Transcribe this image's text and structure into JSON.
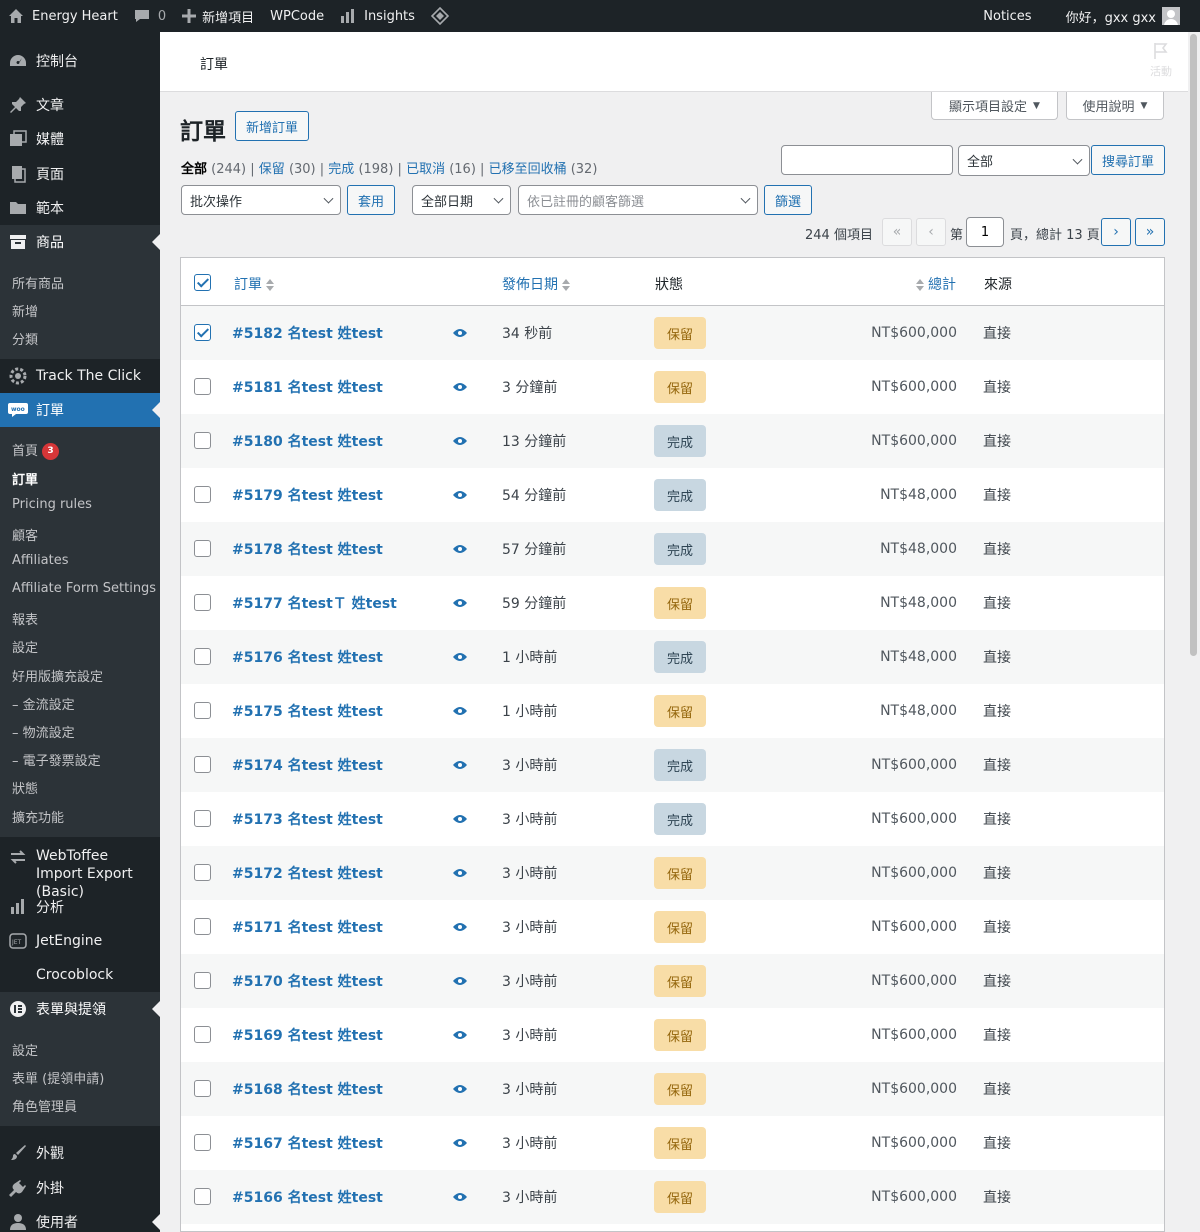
{
  "adminbar": {
    "site_name": "Energy Heart",
    "comments_count": "0",
    "new_item": "新增項目",
    "wpcode": "WPCode",
    "insights": "Insights",
    "notices": "Notices",
    "greeting": "你好，gxx gxx"
  },
  "sidebar": {
    "menu": [
      {
        "label": "控制台",
        "icon": "dashboard-icon"
      },
      {
        "label": "文章",
        "icon": "pin-icon"
      },
      {
        "label": "媒體",
        "icon": "media-icon"
      },
      {
        "label": "頁面",
        "icon": "page-icon"
      },
      {
        "label": "範本",
        "icon": "folder-icon"
      },
      {
        "label": "商品",
        "icon": "archive-icon"
      }
    ],
    "products_sub": [
      "所有商品",
      "新增",
      "分類"
    ],
    "track": "Track The Click",
    "orders": "訂單",
    "orders_sub": [
      "首頁",
      "訂單",
      "Pricing rules",
      "顧客",
      "Affiliates",
      "Affiliate Form Settings",
      "報表",
      "設定",
      "好用版擴充設定",
      "– 金流設定",
      "– 物流設定",
      "– 電子發票設定",
      "狀態",
      "擴充功能"
    ],
    "home_badge": "3",
    "webtoffee": "WebToffee Import Export (Basic)",
    "analytics": "分析",
    "jetengine": "JetEngine",
    "crocoblock": "Crocoblock",
    "forms": "表單與提領",
    "forms_sub": [
      "設定",
      "表單 (提領申請)",
      "角色管理員"
    ],
    "appearance": "外觀",
    "plugins": "外掛",
    "users": "使用者"
  },
  "topbar": {
    "breadcrumb": "訂單",
    "activity": "活動"
  },
  "screen_options": "顯示項目設定",
  "help": "使用說明",
  "page_title": "訂單",
  "add_order": "新增訂單",
  "filters": {
    "all": "全部",
    "all_count": "(244)",
    "hold": "保留",
    "hold_count": "(30)",
    "done": "完成",
    "done_count": "(198)",
    "cancel": "已取消",
    "cancel_count": "(16)",
    "trash": "已移至回收桶",
    "trash_count": "(32)"
  },
  "search": {
    "value": "",
    "type_select": "全部",
    "button": "搜尋訂單"
  },
  "bulk": {
    "select": "批次操作",
    "apply": "套用"
  },
  "date_filter": "全部日期",
  "customer_filter_placeholder": "依已註冊的顧客篩選",
  "filter_button": "篩選",
  "pagination": {
    "items": "244 個項目",
    "first": "«",
    "prev": "‹",
    "page_label": "第",
    "current": "1",
    "of": "頁，總計 13 頁",
    "next": "›",
    "last": "»"
  },
  "columns": {
    "order": "訂單",
    "date": "發佈日期",
    "status": "狀態",
    "total": "總計",
    "origin": "來源"
  },
  "status_colors": {
    "保留": {
      "bg": "#f8dda7",
      "fg": "#94660c"
    },
    "完成": {
      "bg": "#c8d7e1",
      "fg": "#2e4453"
    }
  },
  "orders": [
    {
      "order": "#5182 名test 姓test",
      "date": "34 秒前",
      "status": "保留",
      "total": "NT$600,000",
      "origin": "直接",
      "checked": true
    },
    {
      "order": "#5181 名test 姓test",
      "date": "3 分鐘前",
      "status": "保留",
      "total": "NT$600,000",
      "origin": "直接",
      "checked": false
    },
    {
      "order": "#5180 名test 姓test",
      "date": "13 分鐘前",
      "status": "完成",
      "total": "NT$600,000",
      "origin": "直接",
      "checked": false
    },
    {
      "order": "#5179 名test 姓test",
      "date": "54 分鐘前",
      "status": "完成",
      "total": "NT$48,000",
      "origin": "直接",
      "checked": false
    },
    {
      "order": "#5178 名test 姓test",
      "date": "57 分鐘前",
      "status": "完成",
      "total": "NT$48,000",
      "origin": "直接",
      "checked": false
    },
    {
      "order": "#5177 名testＴ 姓test",
      "date": "59 分鐘前",
      "status": "保留",
      "total": "NT$48,000",
      "origin": "直接",
      "checked": false
    },
    {
      "order": "#5176 名test 姓test",
      "date": "1 小時前",
      "status": "完成",
      "total": "NT$48,000",
      "origin": "直接",
      "checked": false
    },
    {
      "order": "#5175 名test 姓test",
      "date": "1 小時前",
      "status": "保留",
      "total": "NT$48,000",
      "origin": "直接",
      "checked": false
    },
    {
      "order": "#5174 名test 姓test",
      "date": "3 小時前",
      "status": "完成",
      "total": "NT$600,000",
      "origin": "直接",
      "checked": false
    },
    {
      "order": "#5173 名test 姓test",
      "date": "3 小時前",
      "status": "完成",
      "total": "NT$600,000",
      "origin": "直接",
      "checked": false
    },
    {
      "order": "#5172 名test 姓test",
      "date": "3 小時前",
      "status": "保留",
      "total": "NT$600,000",
      "origin": "直接",
      "checked": false
    },
    {
      "order": "#5171 名test 姓test",
      "date": "3 小時前",
      "status": "保留",
      "total": "NT$600,000",
      "origin": "直接",
      "checked": false
    },
    {
      "order": "#5170 名test 姓test",
      "date": "3 小時前",
      "status": "保留",
      "total": "NT$600,000",
      "origin": "直接",
      "checked": false
    },
    {
      "order": "#5169 名test 姓test",
      "date": "3 小時前",
      "status": "保留",
      "total": "NT$600,000",
      "origin": "直接",
      "checked": false
    },
    {
      "order": "#5168 名test 姓test",
      "date": "3 小時前",
      "status": "保留",
      "total": "NT$600,000",
      "origin": "直接",
      "checked": false
    },
    {
      "order": "#5167 名test 姓test",
      "date": "3 小時前",
      "status": "保留",
      "total": "NT$600,000",
      "origin": "直接",
      "checked": false
    },
    {
      "order": "#5166 名test 姓test",
      "date": "3 小時前",
      "status": "保留",
      "total": "NT$600,000",
      "origin": "直接",
      "checked": false
    }
  ]
}
